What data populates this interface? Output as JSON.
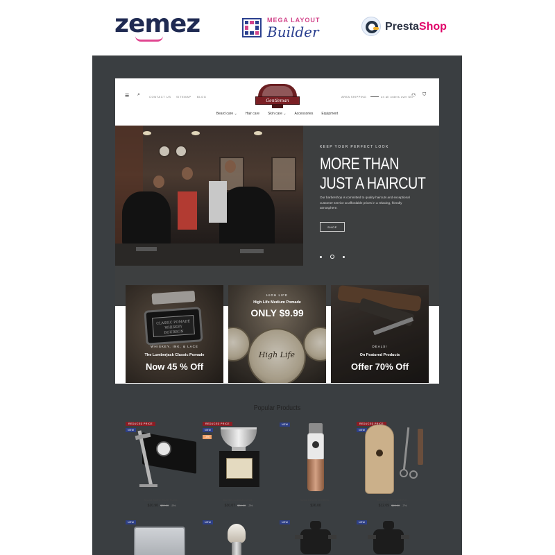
{
  "brands": {
    "zemez": "zemez",
    "mlb_top": "MEGA LAYOUT",
    "mlb_bottom": "Builder",
    "presta_a": "Presta",
    "presta_b": "Shop"
  },
  "header": {
    "top_links": [
      "CONTACT US",
      "SITEMAP",
      "BLOG"
    ],
    "logo_text": "Gentleman",
    "shipping": "AREA SHIPPING",
    "shipping_note": "on all orders over $57",
    "nav": [
      "Beard care ⌄",
      "Hair care",
      "Skin care ⌄",
      "Accessories",
      "Equipment"
    ]
  },
  "hero": {
    "kicker": "KEEP YOUR PERFECT LOOK",
    "title_line1": "MORE THAN",
    "title_line2": "JUST A HAIRCUT",
    "text": "Our barbershop is committed to quality haircuts and exceptional customer service at affordable prices in a relaxing, friendly atmosphere.",
    "button": "SHOP"
  },
  "banners": [
    {
      "kicker": "WHISKEY, INK, & LACE",
      "sub": "The Lumberjack Classic Pomade",
      "big": "Now 45 % Off",
      "tin_text": "CLASSIC POMADE\nWHISKEY\nBOURBON"
    },
    {
      "kicker": "HIGH LIFE",
      "sub": "High Life Medium Pomade",
      "big": "ONLY $9.99",
      "jar_text": "High Life"
    },
    {
      "kicker": "DEALS!",
      "sub": "On Featured Products",
      "big": "Offer 70% Off"
    }
  ],
  "popular": {
    "title": "Popular Products",
    "products": [
      {
        "badge_red": "REDUCED PRICE",
        "badge_blue": "NEW",
        "name": "Sparta Safety Razor Stand...",
        "price": "$20.90",
        "old": "$22.00",
        "disc": "-5%"
      },
      {
        "badge_red": "REDUCED PRICE",
        "badge_blue": "NEW",
        "badge_orange": "-3%",
        "name": "Barbers Clubman Deod...",
        "price": "$30.07",
        "old": "$31.00",
        "disc": "-3%"
      },
      {
        "badge_blue": "NEW",
        "name": "Stand Electric Cordless...",
        "price": "$26.00"
      },
      {
        "badge_red": "REDUCED PRICE",
        "badge_blue": "NEW",
        "name": "Scissors With Comb For...",
        "price": "$12.09",
        "old": "$13.00",
        "disc": "-7%"
      },
      {
        "badge_blue": "NEW"
      },
      {
        "badge_blue": "NEW"
      },
      {
        "badge_blue": "NEW"
      },
      {
        "badge_blue": "NEW"
      }
    ]
  },
  "colors": {
    "frame": "#3a3e41",
    "badge_red": "#8a1d24",
    "badge_blue": "#2d3f86"
  }
}
